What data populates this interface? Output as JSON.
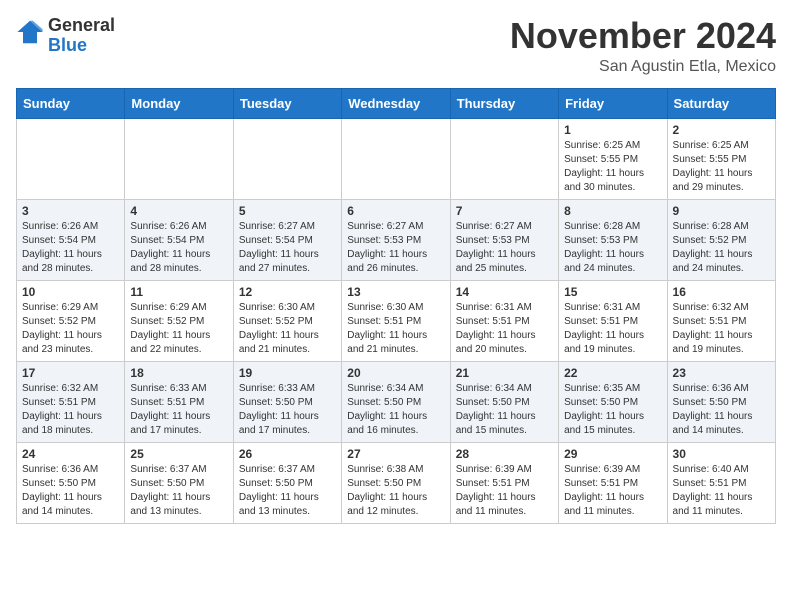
{
  "header": {
    "logo": {
      "general": "General",
      "blue": "Blue"
    },
    "month": "November 2024",
    "location": "San Agustin Etla, Mexico"
  },
  "days_of_week": [
    "Sunday",
    "Monday",
    "Tuesday",
    "Wednesday",
    "Thursday",
    "Friday",
    "Saturday"
  ],
  "weeks": [
    [
      {
        "day": "",
        "info": ""
      },
      {
        "day": "",
        "info": ""
      },
      {
        "day": "",
        "info": ""
      },
      {
        "day": "",
        "info": ""
      },
      {
        "day": "",
        "info": ""
      },
      {
        "day": "1",
        "info": "Sunrise: 6:25 AM\nSunset: 5:55 PM\nDaylight: 11 hours and 30 minutes."
      },
      {
        "day": "2",
        "info": "Sunrise: 6:25 AM\nSunset: 5:55 PM\nDaylight: 11 hours and 29 minutes."
      }
    ],
    [
      {
        "day": "3",
        "info": "Sunrise: 6:26 AM\nSunset: 5:54 PM\nDaylight: 11 hours and 28 minutes."
      },
      {
        "day": "4",
        "info": "Sunrise: 6:26 AM\nSunset: 5:54 PM\nDaylight: 11 hours and 28 minutes."
      },
      {
        "day": "5",
        "info": "Sunrise: 6:27 AM\nSunset: 5:54 PM\nDaylight: 11 hours and 27 minutes."
      },
      {
        "day": "6",
        "info": "Sunrise: 6:27 AM\nSunset: 5:53 PM\nDaylight: 11 hours and 26 minutes."
      },
      {
        "day": "7",
        "info": "Sunrise: 6:27 AM\nSunset: 5:53 PM\nDaylight: 11 hours and 25 minutes."
      },
      {
        "day": "8",
        "info": "Sunrise: 6:28 AM\nSunset: 5:53 PM\nDaylight: 11 hours and 24 minutes."
      },
      {
        "day": "9",
        "info": "Sunrise: 6:28 AM\nSunset: 5:52 PM\nDaylight: 11 hours and 24 minutes."
      }
    ],
    [
      {
        "day": "10",
        "info": "Sunrise: 6:29 AM\nSunset: 5:52 PM\nDaylight: 11 hours and 23 minutes."
      },
      {
        "day": "11",
        "info": "Sunrise: 6:29 AM\nSunset: 5:52 PM\nDaylight: 11 hours and 22 minutes."
      },
      {
        "day": "12",
        "info": "Sunrise: 6:30 AM\nSunset: 5:52 PM\nDaylight: 11 hours and 21 minutes."
      },
      {
        "day": "13",
        "info": "Sunrise: 6:30 AM\nSunset: 5:51 PM\nDaylight: 11 hours and 21 minutes."
      },
      {
        "day": "14",
        "info": "Sunrise: 6:31 AM\nSunset: 5:51 PM\nDaylight: 11 hours and 20 minutes."
      },
      {
        "day": "15",
        "info": "Sunrise: 6:31 AM\nSunset: 5:51 PM\nDaylight: 11 hours and 19 minutes."
      },
      {
        "day": "16",
        "info": "Sunrise: 6:32 AM\nSunset: 5:51 PM\nDaylight: 11 hours and 19 minutes."
      }
    ],
    [
      {
        "day": "17",
        "info": "Sunrise: 6:32 AM\nSunset: 5:51 PM\nDaylight: 11 hours and 18 minutes."
      },
      {
        "day": "18",
        "info": "Sunrise: 6:33 AM\nSunset: 5:51 PM\nDaylight: 11 hours and 17 minutes."
      },
      {
        "day": "19",
        "info": "Sunrise: 6:33 AM\nSunset: 5:50 PM\nDaylight: 11 hours and 17 minutes."
      },
      {
        "day": "20",
        "info": "Sunrise: 6:34 AM\nSunset: 5:50 PM\nDaylight: 11 hours and 16 minutes."
      },
      {
        "day": "21",
        "info": "Sunrise: 6:34 AM\nSunset: 5:50 PM\nDaylight: 11 hours and 15 minutes."
      },
      {
        "day": "22",
        "info": "Sunrise: 6:35 AM\nSunset: 5:50 PM\nDaylight: 11 hours and 15 minutes."
      },
      {
        "day": "23",
        "info": "Sunrise: 6:36 AM\nSunset: 5:50 PM\nDaylight: 11 hours and 14 minutes."
      }
    ],
    [
      {
        "day": "24",
        "info": "Sunrise: 6:36 AM\nSunset: 5:50 PM\nDaylight: 11 hours and 14 minutes."
      },
      {
        "day": "25",
        "info": "Sunrise: 6:37 AM\nSunset: 5:50 PM\nDaylight: 11 hours and 13 minutes."
      },
      {
        "day": "26",
        "info": "Sunrise: 6:37 AM\nSunset: 5:50 PM\nDaylight: 11 hours and 13 minutes."
      },
      {
        "day": "27",
        "info": "Sunrise: 6:38 AM\nSunset: 5:50 PM\nDaylight: 11 hours and 12 minutes."
      },
      {
        "day": "28",
        "info": "Sunrise: 6:39 AM\nSunset: 5:51 PM\nDaylight: 11 hours and 11 minutes."
      },
      {
        "day": "29",
        "info": "Sunrise: 6:39 AM\nSunset: 5:51 PM\nDaylight: 11 hours and 11 minutes."
      },
      {
        "day": "30",
        "info": "Sunrise: 6:40 AM\nSunset: 5:51 PM\nDaylight: 11 hours and 11 minutes."
      }
    ]
  ]
}
